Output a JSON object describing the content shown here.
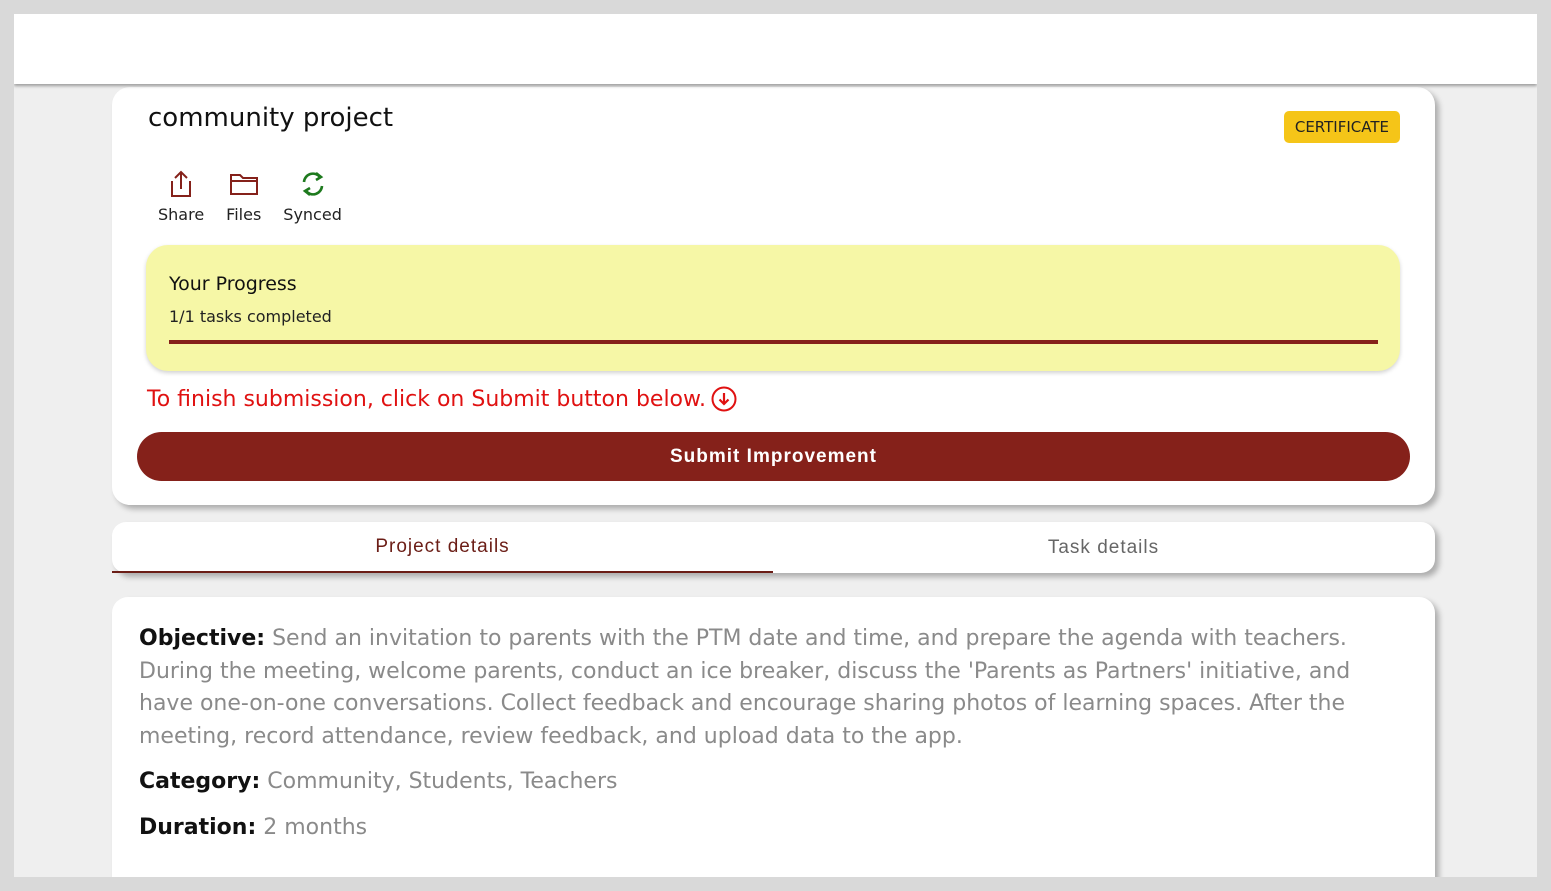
{
  "project": {
    "title": "community project",
    "certificate_label": "CERTIFICATE"
  },
  "actions": [
    {
      "label": "Share",
      "icon": "share-icon"
    },
    {
      "label": "Files",
      "icon": "folder-icon"
    },
    {
      "label": "Synced",
      "icon": "sync-icon"
    }
  ],
  "progress": {
    "title": "Your Progress",
    "subtitle": "1/1 tasks completed",
    "fraction": 1.0
  },
  "hint": {
    "text": "To finish submission, click on Submit button below.",
    "icon": "arrow-down-circle-icon"
  },
  "submit_label": "Submit Improvement",
  "tabs": [
    {
      "label": "Project details",
      "active": true
    },
    {
      "label": "Task details",
      "active": false
    }
  ],
  "details": {
    "objective_label": "Objective:",
    "objective_value": "Send an invitation to parents with the PTM date and time, and prepare the agenda with teachers. During the meeting, welcome parents, conduct an ice breaker, discuss the 'Parents as Partners' initiative, and have one-on-one conversations. Collect feedback and encourage sharing photos of learning spaces. After the meeting, record attendance, review feedback, and upload data to the app.",
    "category_label": "Category:",
    "category_value": "Community, Students, Teachers",
    "duration_label": "Duration:",
    "duration_value": "2 months"
  },
  "colors": {
    "brand": "#85211a",
    "certificate": "#f5c518",
    "progress_bg": "#f6f7a6",
    "hint": "#e01111",
    "synced": "#1e7a1e"
  }
}
